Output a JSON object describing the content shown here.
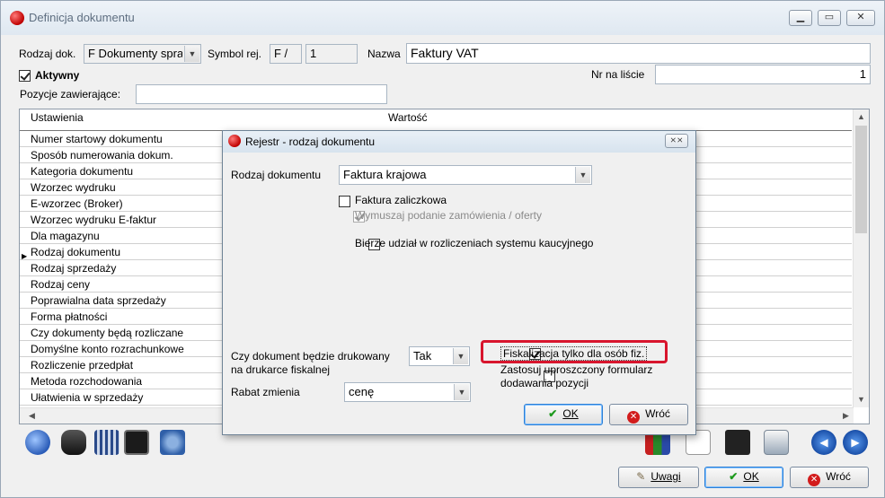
{
  "window": {
    "title": "Definicja dokumentu",
    "rodzaj_dok_label": "Rodzaj dok.",
    "rodzaj_dok_value": "F  Dokumenty spra",
    "symbol_label": "Symbol rej.",
    "symbol_value": "F /",
    "symbol_number": "1",
    "nazwa_label": "Nazwa",
    "nazwa_value": "Faktury VAT",
    "aktywny_label": "Aktywny",
    "nr_label": "Nr na liście",
    "nr_value": "1",
    "pozycje_label": "Pozycje zawierające:",
    "pozycje_value": ""
  },
  "grid": {
    "col_ustawienia": "Ustawienia",
    "col_wartosc": "Wartość",
    "rows": [
      "Numer startowy dokumentu",
      "Sposób numerowania dokum.",
      "Kategoria dokumentu",
      "Wzorzec wydruku",
      "E-wzorzec (Broker)",
      "Wzorzec wydruku E-faktur",
      "Dla magazynu",
      "Rodzaj dokumentu",
      "Rodzaj sprzedaży",
      "Rodzaj ceny",
      "Poprawialna data sprzedaży",
      "Forma płatności",
      "Czy dokumenty będą rozliczane",
      "Domyślne konto rozrachunkowe",
      "Rozliczenie przedpłat",
      "Metoda rozchodowania",
      "Ułatwienia w sprzedaży"
    ]
  },
  "dialog": {
    "title": "Rejestr - rodzaj dokumentu",
    "close_glyph": "⨯⨯",
    "rodzaj_label": "Rodzaj dokumentu",
    "rodzaj_value": "Faktura krajowa",
    "zaliczkowa_label": "Faktura zaliczkowa",
    "wymuszaj_label": "Wymuszaj podanie zamówienia / oferty",
    "kaucyjny_label": "Bierze udział w rozliczeniach systemu kaucyjnego",
    "drukowany_label_1": "Czy dokument będzie drukowany",
    "drukowany_label_2": "na drukarce fiskalnej",
    "drukowany_value": "Tak",
    "rabat_label": "Rabat zmienia",
    "rabat_value": "cenę",
    "fiskalizacja_label": "Fiskalizacja tylko dla osób fiz.",
    "uproszczony_label_1": "Zastosuj uproszczony formularz",
    "uproszczony_label_2": "dodawania pozycji",
    "ok_label": "OK",
    "cancel_label": "Wróć"
  },
  "footer": {
    "uwagi_label": "Uwagi",
    "ok_label": "OK",
    "cancel_label": "Wróć"
  },
  "colors": {
    "highlight": "#d8152d",
    "ok_green": "#1e9a1e",
    "cancel_red": "#d21c1c"
  }
}
